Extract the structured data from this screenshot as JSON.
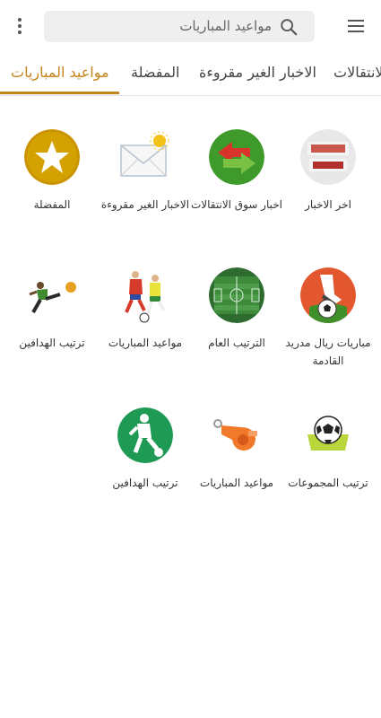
{
  "header": {
    "search_placeholder": "مواعيد المباريات"
  },
  "tabs": [
    {
      "label": "الانتقالات"
    },
    {
      "label": "الاخبار الغير مقروءة"
    },
    {
      "label": "المفضلة"
    },
    {
      "label": "مواعيد المباريات",
      "active": true
    }
  ],
  "accent_color": "#c8841c",
  "grid": [
    {
      "label": "اخر الاخبار",
      "icon": "sports-news-logo-icon"
    },
    {
      "label": "اخبار سوق الانتقالات",
      "icon": "transfer-arrows-icon"
    },
    {
      "label": "الاخبار الغير مقروءة",
      "icon": "envelope-icon"
    },
    {
      "label": "المفضلة",
      "icon": "star-icon"
    },
    {
      "label": "مباريات ريال مدريد القادمة",
      "icon": "football-kick-icon"
    },
    {
      "label": "الترتيب العام",
      "icon": "football-pitch-icon"
    },
    {
      "label": "مواعيد المباريات",
      "icon": "football-players-icon"
    },
    {
      "label": "ترتيب الهدافين",
      "icon": "player-kicking-ball-icon"
    },
    {
      "label": "ترتيب المجموعات",
      "icon": "football-icon"
    },
    {
      "label": "مواعيد المباريات",
      "icon": "whistle-icon"
    },
    {
      "label": "ترتيب الهدافين",
      "icon": "player-silhouette-icon"
    }
  ]
}
